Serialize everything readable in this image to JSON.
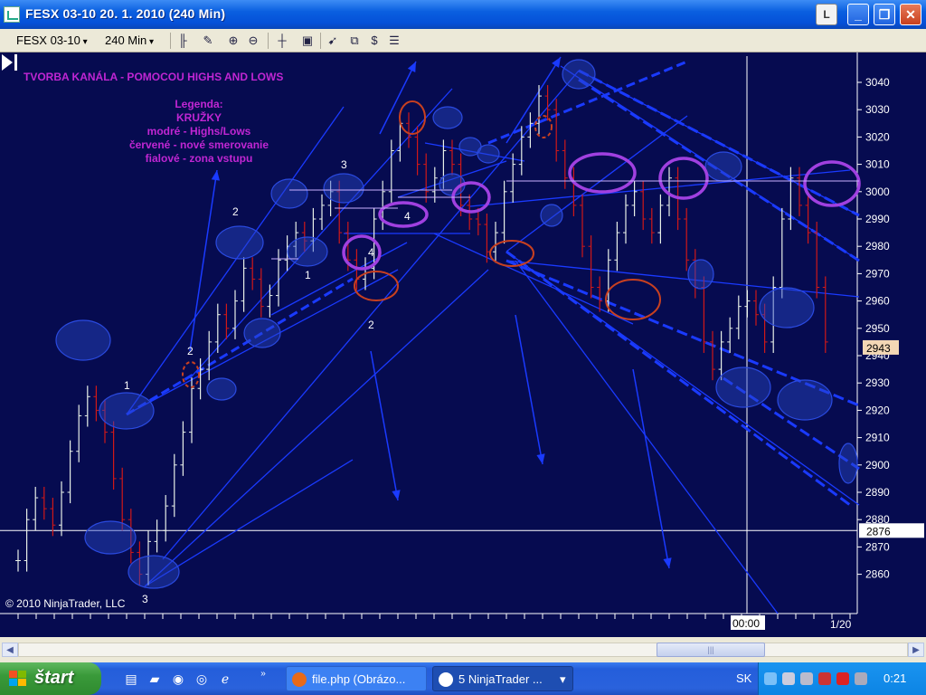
{
  "window": {
    "title": "FESX 03-10  20. 1. 2010 (240 Min)",
    "l_label": "L",
    "min_label": "_",
    "max_label": "❐",
    "close_label": "✕"
  },
  "toolbar": {
    "instrument": "FESX 03-10",
    "interval": "240 Min"
  },
  "chart": {
    "heading": "TVORBA KANÁLA - POMOCOU HIGHS AND LOWS",
    "legend": [
      "Legenda:",
      "KRUŽKY",
      "modré - Highs/Lows",
      "červené - nové smerovanie",
      "fialové - zona vstupu"
    ],
    "copyright": "© 2010 NinjaTrader, LLC",
    "time_marker": "00:00",
    "date_marker": "1/20",
    "price_current": "2943",
    "price_crosshair": "2876",
    "price_ticks": [
      "3040",
      "3030",
      "3020",
      "3010",
      "3000",
      "2990",
      "2980",
      "2970",
      "2960",
      "2950",
      "2940",
      "2930",
      "2920",
      "2910",
      "2900",
      "2890",
      "2880",
      "2870",
      "2860"
    ],
    "wave_labels": [
      "1",
      "2",
      "3",
      "2",
      "3",
      "1",
      "4",
      "2",
      "4"
    ],
    "colors": {
      "background": "#060b50",
      "up_bar": "#e8f0e8",
      "down_bar": "#d01818",
      "blue_line": "#1a3aff",
      "purple_circle": "#a040e0",
      "red_circle": "#c84020"
    }
  },
  "taskbar": {
    "start_label": "štart",
    "task1": "file.php (Obrázo...",
    "task2": "5 NinjaTrader ...",
    "lang": "SK",
    "clock": "0:21"
  }
}
